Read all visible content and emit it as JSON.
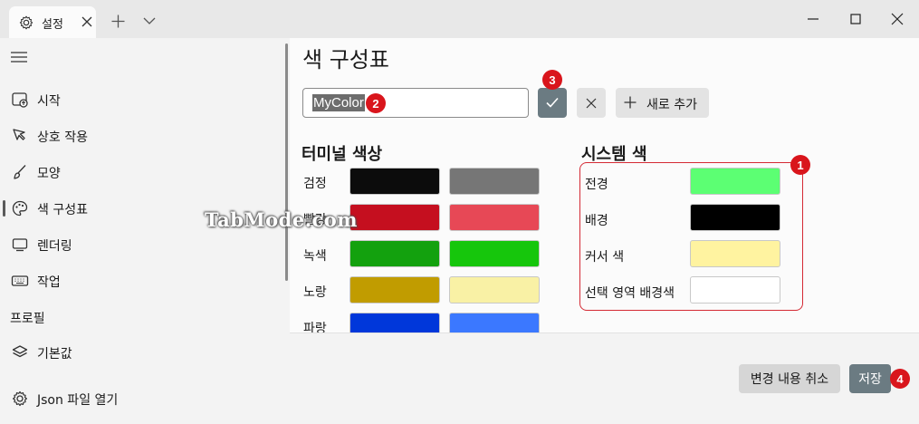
{
  "titlebar": {
    "tab_label": "설정",
    "icons": [
      "gear-icon",
      "close-icon",
      "plus-icon",
      "chevron-down-icon",
      "minimize-icon",
      "maximize-icon",
      "window-close-icon"
    ]
  },
  "sidebar": {
    "items": [
      {
        "label": "시작",
        "icon": "launch-icon"
      },
      {
        "label": "상호 작용",
        "icon": "pointer-icon"
      },
      {
        "label": "모양",
        "icon": "brush-icon"
      },
      {
        "label": "색 구성표",
        "icon": "palette-icon"
      },
      {
        "label": "렌더링",
        "icon": "monitor-icon"
      },
      {
        "label": "작업",
        "icon": "keyboard-icon"
      }
    ],
    "profiles_label": "프로필",
    "profile_items": [
      {
        "label": "기본값",
        "icon": "layers-icon"
      }
    ],
    "open_json_label": "Json 파일 열기"
  },
  "main": {
    "title": "색 구성표",
    "scheme_name": "MyColor",
    "add_new_label": "새로 추가",
    "terminal_colors_heading": "터미널 색상",
    "terminal_colors": [
      {
        "label": "검정",
        "normal": "#0c0c0c",
        "bright": "#767676"
      },
      {
        "label": "빨강",
        "normal": "#c50f1f",
        "bright": "#e74856"
      },
      {
        "label": "녹색",
        "normal": "#13a10e",
        "bright": "#16c60c"
      },
      {
        "label": "노랑",
        "normal": "#c19c00",
        "bright": "#f9f1a5"
      },
      {
        "label": "파랑",
        "normal": "#0037da",
        "bright": "#3b78ff"
      }
    ],
    "system_colors_heading": "시스템 색",
    "system_colors": [
      {
        "label": "전경",
        "color": "#5cff73"
      },
      {
        "label": "배경",
        "color": "#000000"
      },
      {
        "label": "커서 색",
        "color": "#fff3a0"
      },
      {
        "label": "선택 영역 배경색",
        "color": "#ffffff"
      }
    ],
    "discard_changes_label": "변경 내용 취소",
    "save_label": "저장"
  },
  "markers": [
    "1",
    "2",
    "3",
    "4"
  ],
  "watermark": "TabMode.com",
  "colors": {
    "accent": "#6b7b82",
    "marker": "#d9151c",
    "highlight_box": "#d42a34"
  }
}
